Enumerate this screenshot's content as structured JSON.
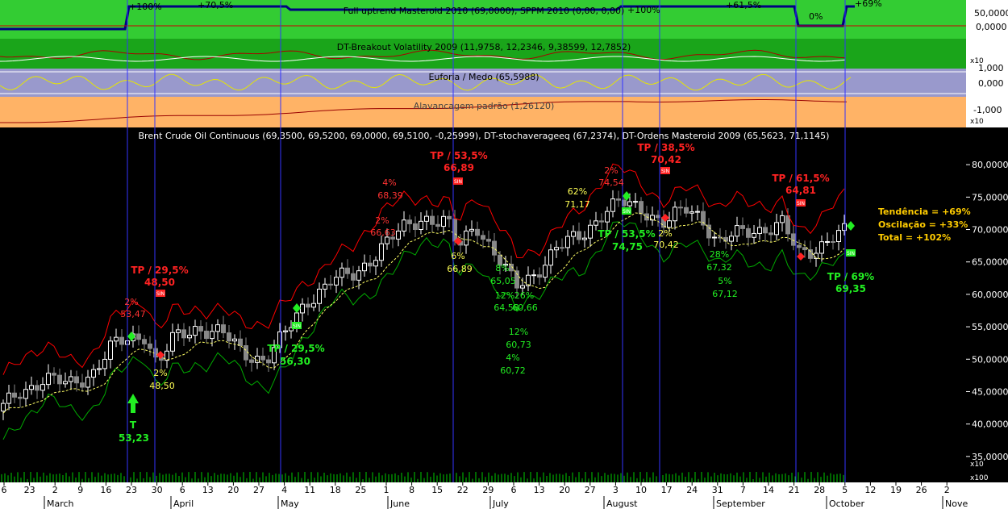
{
  "panels": {
    "masteroid": {
      "title": "Full uptrend Masteroid 2010 (69,0000), SPPM 2010 (0,00, 0,00)",
      "axis_labels": [
        "50,0000",
        "0,0000"
      ],
      "percent_labels": [
        "+100%",
        "+70,5%",
        "+100%",
        "+61,5%",
        "0%",
        "+69%"
      ],
      "colors": {
        "bg": "#33cc33",
        "line": "#000080",
        "signal": "#cc0000"
      }
    },
    "volatility": {
      "title": "DT-Breakout Volatility 2009 (11,9758, 12,2346, 9,38599, 12,7852)",
      "axis_labels": [
        "x10"
      ],
      "colors": {
        "bg": "#1aa51a"
      }
    },
    "euforia": {
      "title": "Euforia / Medo (65,5988)",
      "axis_labels": [
        "1,000",
        "0,000",
        "-1,000"
      ],
      "colors": {
        "bg": "#9999cc",
        "line": "#e6e600"
      }
    },
    "alavancagem": {
      "title": "Alavancagem padrão (1,26120)",
      "axis_labels": [
        "x10"
      ],
      "colors": {
        "bg": "#ffb366",
        "line": "#990000"
      }
    },
    "main": {
      "title": "Brent Crude Oil Continuous (69,3500, 69,5200, 69,0000, 69,5100, -0,25999), DT-stochaverageeq (67,2374), DT-Ordens Masteroid 2009 (65,5623, 71,1145)",
      "price_labels": [
        "80,0000",
        "75,0000",
        "70,0000",
        "65,0000",
        "60,0000",
        "55,0000",
        "50,0000",
        "45,0000",
        "40,0000",
        "35,0000"
      ],
      "volume_labels": [
        "x10",
        "x100"
      ],
      "summary": [
        "Tendência = +69%",
        "Oscilação = +33%",
        "Total = +102%"
      ],
      "annotations_red": [
        {
          "a": "TP / 29,5%",
          "b": "48,50"
        },
        {
          "a": "TP / 53,5%",
          "b": "66,89"
        },
        {
          "a": "TP / 38,5%",
          "b": "70,42"
        },
        {
          "a": "TP / 61,5%",
          "b": "64,81"
        }
      ],
      "annotations_small_red": [
        "2%",
        "53,47",
        "2%",
        "66,63",
        "4%",
        "68,39",
        "2%",
        "74,54"
      ],
      "annotations_yellow": [
        "2%",
        "48,50",
        "6%",
        "66,89",
        "62%",
        "71,17",
        "2%",
        "70,42"
      ],
      "annotations_green": [
        {
          "a": "T",
          "b": "53,23"
        },
        {
          "a": "TP / 29,5%",
          "b": "56,30"
        },
        {
          "a": "TP / 53,5%",
          "b": "74,75"
        },
        {
          "a": "TP / 69%",
          "b": "69,35"
        }
      ],
      "annotations_small_green": [
        "8%",
        "65,05",
        "12%",
        "64,58",
        "26%",
        "60,66",
        "12%",
        "60,73",
        "4%",
        "60,72",
        "28%",
        "67,32",
        "5%",
        "67,12"
      ],
      "badge_text": "SIN",
      "colors": {
        "up": "#ffffff",
        "down": "#888888",
        "upper_band": "#ff0000",
        "lower_band": "#00aa00",
        "avg": "#ffff66",
        "vline": "#3333ff",
        "summary": "#ffcc00"
      }
    }
  },
  "xaxis": {
    "day_labels": [
      "6",
      "23",
      "2",
      "9",
      "16",
      "23",
      "30",
      "6",
      "13",
      "20",
      "27",
      "4",
      "11",
      "18",
      "25",
      "1",
      "8",
      "15",
      "22",
      "29",
      "6",
      "13",
      "20",
      "27",
      "3",
      "10",
      "17",
      "24",
      "31",
      "7",
      "14",
      "21",
      "28",
      "5",
      "12",
      "19",
      "26",
      "2"
    ],
    "month_labels": [
      "March",
      "April",
      "May",
      "June",
      "July",
      "August",
      "September",
      "October",
      "Nove"
    ]
  },
  "chart_data": {
    "type": "candlestick",
    "title": "Brent Crude Oil Continuous",
    "ylim": [
      31,
      84
    ],
    "series": [
      {
        "name": "DT-stochaverageeq",
        "values": []
      },
      {
        "name": "DT-Ordens Masteroid 2009",
        "values": []
      }
    ],
    "key_points": [
      {
        "label": "T",
        "value": 53.23
      },
      {
        "label": "TP / 29,5%",
        "value": 48.5
      },
      {
        "label": "TP / 29,5%",
        "value": 56.3
      },
      {
        "label": "TP / 53,5%",
        "value": 66.89
      },
      {
        "label": "TP / 38,5%",
        "value": 70.42
      },
      {
        "label": "TP / 53,5%",
        "value": 74.75
      },
      {
        "label": "TP / 61,5%",
        "value": 64.81
      },
      {
        "label": "TP / 69%",
        "value": 69.35
      }
    ],
    "last_close": 69.51
  }
}
